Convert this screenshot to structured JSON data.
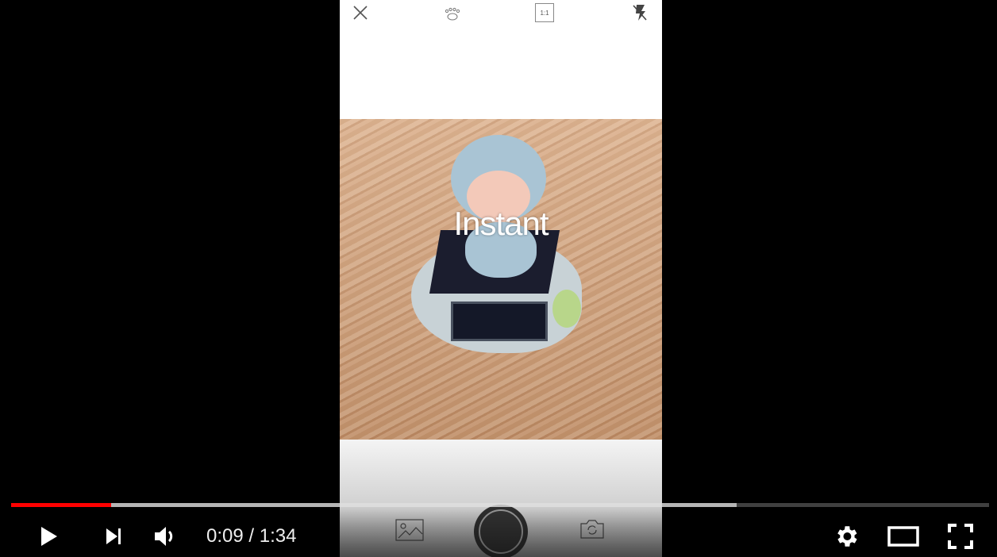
{
  "camera": {
    "overlay_text": "Instant",
    "aspect_label": "1:1",
    "icons": [
      "close-icon",
      "paw-icon",
      "aspect-ratio-icon",
      "flash-off-icon",
      "gallery-icon",
      "shutter-button",
      "switch-camera-icon"
    ]
  },
  "player": {
    "current_time": "0:09",
    "duration": "1:34",
    "time_display": "0:09 / 1:34",
    "played_fraction": 0.102,
    "buffered_fraction": 0.742,
    "accent": "#ff0000",
    "icons": [
      "play-icon",
      "next-icon",
      "volume-icon",
      "settings-icon",
      "theater-mode-icon",
      "fullscreen-icon"
    ]
  }
}
